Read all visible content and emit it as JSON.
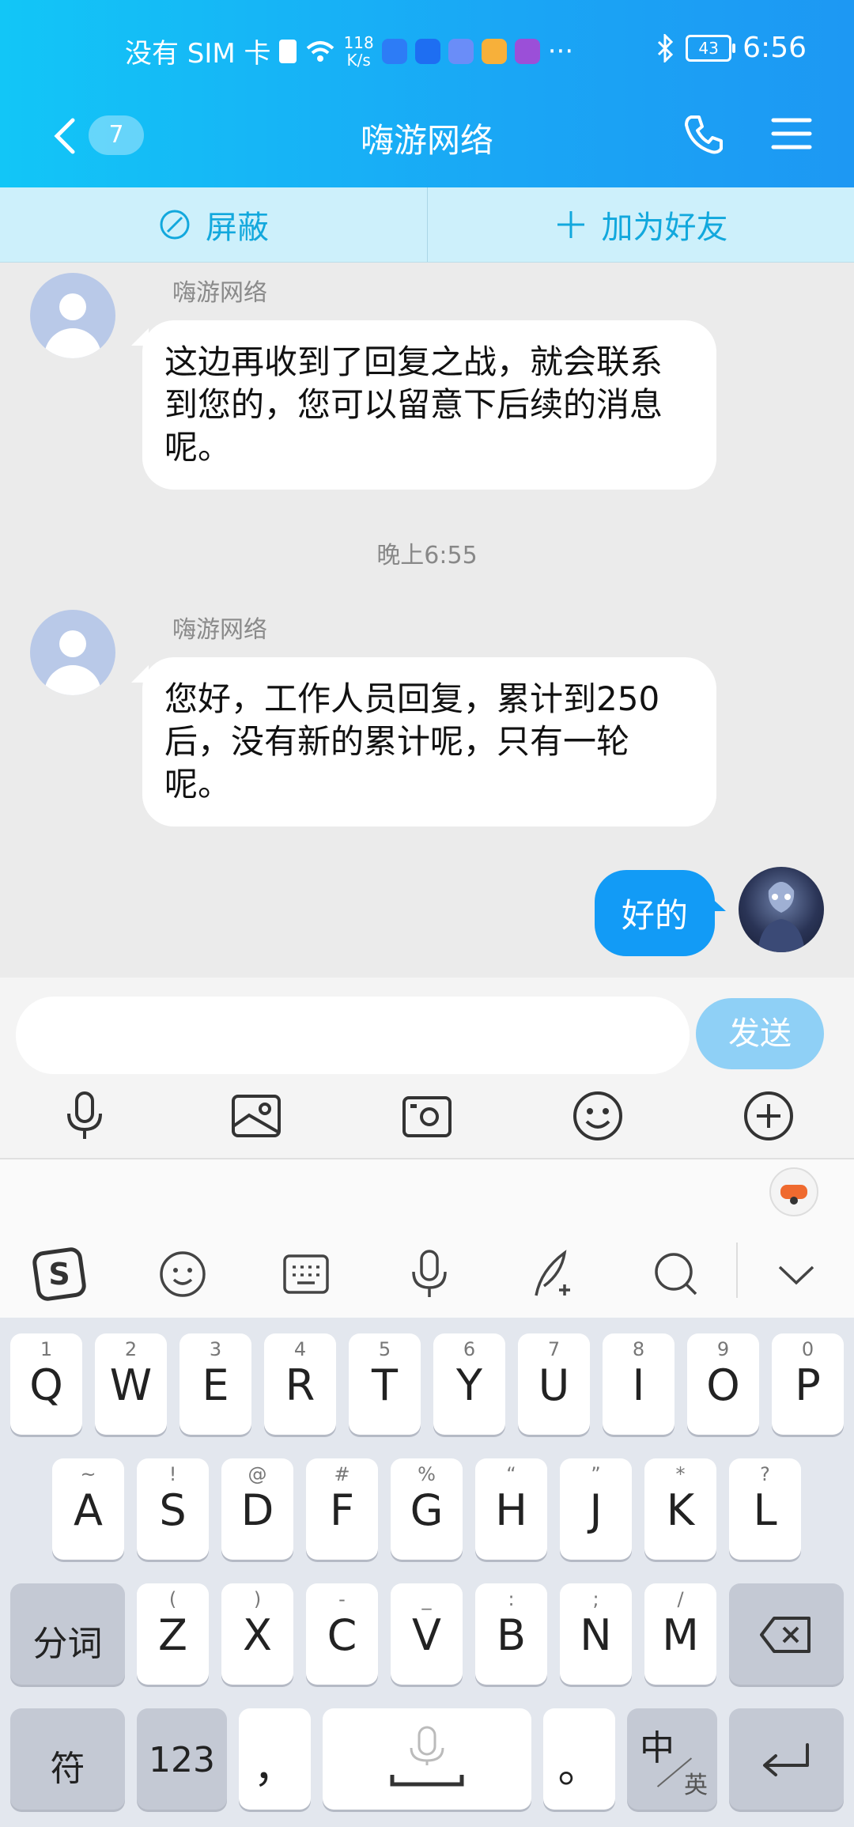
{
  "status_bar": {
    "carrier": "没有 SIM 卡",
    "net_speed_value": "118",
    "net_speed_unit": "K/s",
    "more": "···",
    "battery": "43",
    "time": "6:56"
  },
  "header": {
    "unread_count": "7",
    "title": "嗨游网络"
  },
  "action_bar": {
    "block_label": "屏蔽",
    "add_friend_label": "加为好友"
  },
  "messages": [
    {
      "sender": "嗨游网络",
      "text": "这边再收到了回复之战，就会联系到您的，您可以留意下后续的消息呢。"
    },
    {
      "time": "晚上6:55"
    },
    {
      "sender": "嗨游网络",
      "text": "您好，工作人员回复，累计到250后，没有新的累计呢，只有一轮呢。"
    },
    {
      "self": true,
      "text": "好的"
    }
  ],
  "input": {
    "placeholder": "",
    "send_label": "发送"
  },
  "keyboard": {
    "row1": [
      {
        "sup": "1",
        "key": "Q"
      },
      {
        "sup": "2",
        "key": "W"
      },
      {
        "sup": "3",
        "key": "E"
      },
      {
        "sup": "4",
        "key": "R"
      },
      {
        "sup": "5",
        "key": "T"
      },
      {
        "sup": "6",
        "key": "Y"
      },
      {
        "sup": "7",
        "key": "U"
      },
      {
        "sup": "8",
        "key": "I"
      },
      {
        "sup": "9",
        "key": "O"
      },
      {
        "sup": "0",
        "key": "P"
      }
    ],
    "row2": [
      {
        "sup": "~",
        "key": "A"
      },
      {
        "sup": "!",
        "key": "S"
      },
      {
        "sup": "@",
        "key": "D"
      },
      {
        "sup": "#",
        "key": "F"
      },
      {
        "sup": "%",
        "key": "G"
      },
      {
        "sup": "“",
        "key": "H"
      },
      {
        "sup": "”",
        "key": "J"
      },
      {
        "sup": "*",
        "key": "K"
      },
      {
        "sup": "?",
        "key": "L"
      }
    ],
    "row3": [
      {
        "sup": "(",
        "key": "Z"
      },
      {
        "sup": ")",
        "key": "X"
      },
      {
        "sup": "-",
        "key": "C"
      },
      {
        "sup": "_",
        "key": "V"
      },
      {
        "sup": ":",
        "key": "B"
      },
      {
        "sup": ";",
        "key": "N"
      },
      {
        "sup": "/",
        "key": "M"
      }
    ],
    "fenci": "分词",
    "symbols": "符",
    "numbers": "123",
    "comma": "，",
    "period": "。",
    "lang_main": "中",
    "lang_sub": "英"
  }
}
